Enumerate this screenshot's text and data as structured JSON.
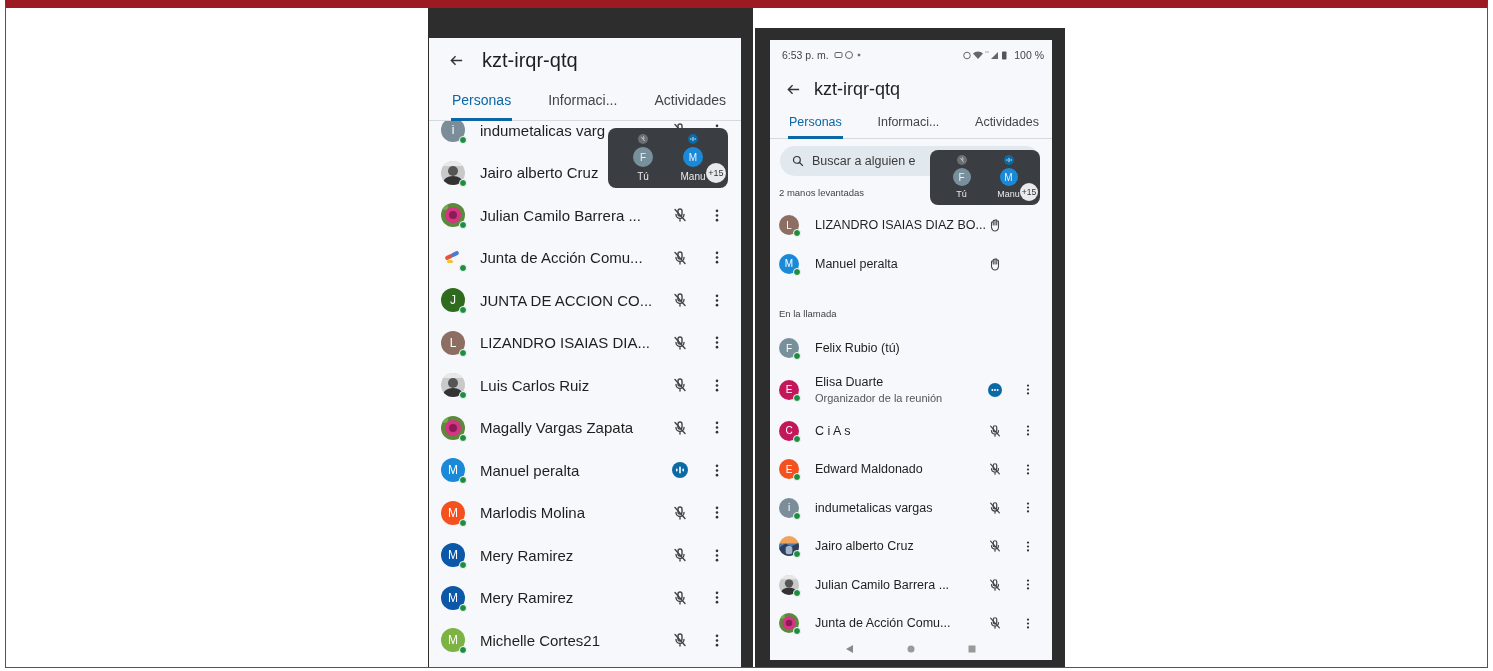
{
  "left_screen": {
    "title": "kzt-irqr-qtq",
    "tabs": [
      {
        "label": "Personas",
        "selected": true
      },
      {
        "label": "Informaci...",
        "selected": false
      },
      {
        "label": "Actividades",
        "selected": false
      }
    ],
    "participants": [
      {
        "name": "indumetalicas varg",
        "avatar": {
          "kind": "letter",
          "letter": "i",
          "color": "#7b8d98"
        },
        "indicator": {
          "kind": "muted"
        },
        "menu": true
      },
      {
        "name": "Jairo alberto Cruz",
        "menu": false
      },
      {
        "name": "Julian Camilo Barrera ...",
        "indicator": {
          "kind": "muted"
        },
        "menu": true
      },
      {
        "name": "Junta de Acción Comu...",
        "indicator": {
          "kind": "muted"
        },
        "menu": true
      },
      {
        "name": "JUNTA DE ACCION CO...",
        "avatar": {
          "kind": "letter",
          "letter": "J",
          "color": "#2e6b1f"
        },
        "indicator": {
          "kind": "muted"
        },
        "menu": true
      },
      {
        "name": "LIZANDRO ISAIAS DIA...",
        "avatar": {
          "kind": "letter",
          "letter": "L",
          "color": "#8d6e63"
        },
        "indicator": {
          "kind": "muted"
        },
        "menu": true
      },
      {
        "name": "Luis Carlos Ruiz",
        "indicator": {
          "kind": "muted"
        },
        "menu": true
      },
      {
        "name": "Magally Vargas Zapata",
        "indicator": {
          "kind": "muted"
        },
        "menu": true
      },
      {
        "name": "Manuel peralta",
        "avatar": {
          "kind": "letter",
          "letter": "M",
          "color": "#1a8ad8"
        },
        "indicator": {
          "kind": "speaking"
        },
        "menu": true
      },
      {
        "name": "Marlodis Molina",
        "avatar": {
          "kind": "letter",
          "letter": "M",
          "color": "#f4511e"
        },
        "indicator": {
          "kind": "muted"
        },
        "menu": true
      },
      {
        "name": "Mery Ramirez",
        "avatar": {
          "kind": "letter",
          "letter": "M",
          "color": "#0b57a8"
        },
        "indicator": {
          "kind": "muted"
        },
        "menu": true
      },
      {
        "name": "Mery Ramirez",
        "avatar": {
          "kind": "letter",
          "letter": "M",
          "color": "#0b57a8"
        },
        "indicator": {
          "kind": "muted"
        },
        "menu": true
      },
      {
        "name": "Michelle Cortes21",
        "avatar": {
          "kind": "letter",
          "letter": "M",
          "color": "#7cb342"
        },
        "indicator": {
          "kind": "muted"
        },
        "menu": true
      }
    ],
    "call_overlay": {
      "tiles": [
        {
          "letter": "F",
          "color": "#78909c",
          "label": "Tú",
          "badge": {
            "kind": "muted"
          }
        },
        {
          "letter": "M",
          "color": "#1a8ad8",
          "label": "Manu",
          "badge": {
            "kind": "speaking"
          }
        }
      ],
      "more": "+15"
    }
  },
  "right_screen": {
    "status_bar": {
      "time": "6:53 p. m.",
      "battery": "100 %"
    },
    "title": "kzt-irqr-qtq",
    "tabs": [
      {
        "label": "Personas",
        "selected": true
      },
      {
        "label": "Informaci...",
        "selected": false
      },
      {
        "label": "Actividades",
        "selected": false
      }
    ],
    "search": {
      "placeholder": "Buscar a alguien e"
    },
    "sections": [
      {
        "label": "2 manos levantadas",
        "participants": [
          {
            "name": "LIZANDRO ISAIAS DIAZ BO...",
            "avatar": {
              "kind": "letter",
              "letter": "L",
              "color": "#8d6e63"
            },
            "indicator": {
              "kind": "hand"
            },
            "menu": false
          },
          {
            "name": "Manuel peralta",
            "avatar": {
              "kind": "letter",
              "letter": "M",
              "color": "#1a8ad8"
            },
            "indicator": {
              "kind": "hand"
            },
            "menu": false
          }
        ]
      },
      {
        "label": "En la llamada",
        "participants": [
          {
            "name": "Felix Rubio (tú)",
            "avatar": {
              "kind": "letter",
              "letter": "F",
              "color": "#78909c"
            },
            "menu": false
          },
          {
            "name": "Elisa Duarte",
            "subtitle": "Organizador de la reunión",
            "avatar": {
              "kind": "letter",
              "letter": "E",
              "color": "#c2185b"
            },
            "indicator": {
              "kind": "dots"
            },
            "menu": true
          },
          {
            "name": "C i A s",
            "avatar": {
              "kind": "letter",
              "letter": "C",
              "color": "#c2185b"
            },
            "indicator": {
              "kind": "muted"
            },
            "menu": true
          },
          {
            "name": "Edward Maldonado",
            "avatar": {
              "kind": "letter",
              "letter": "E",
              "color": "#f4511e"
            },
            "indicator": {
              "kind": "muted"
            },
            "menu": true
          },
          {
            "name": "indumetalicas vargas",
            "avatar": {
              "kind": "letter",
              "letter": "i",
              "color": "#7b8d98"
            },
            "indicator": {
              "kind": "muted"
            },
            "menu": true
          },
          {
            "name": "Jairo alberto Cruz",
            "indicator": {
              "kind": "muted"
            },
            "menu": true
          },
          {
            "name": "Julian Camilo Barrera ...",
            "indicator": {
              "kind": "muted"
            },
            "menu": true
          },
          {
            "name": "Junta de Acción Comu...",
            "indicator": {
              "kind": "muted"
            },
            "menu": true
          }
        ]
      }
    ],
    "call_overlay": {
      "tiles": [
        {
          "letter": "F",
          "color": "#78909c",
          "label": "Tú",
          "badge": {
            "kind": "muted"
          }
        },
        {
          "letter": "M",
          "color": "#1a8ad8",
          "label": "Manu",
          "badge": {
            "kind": "speaking"
          }
        }
      ],
      "more": "+15"
    }
  }
}
